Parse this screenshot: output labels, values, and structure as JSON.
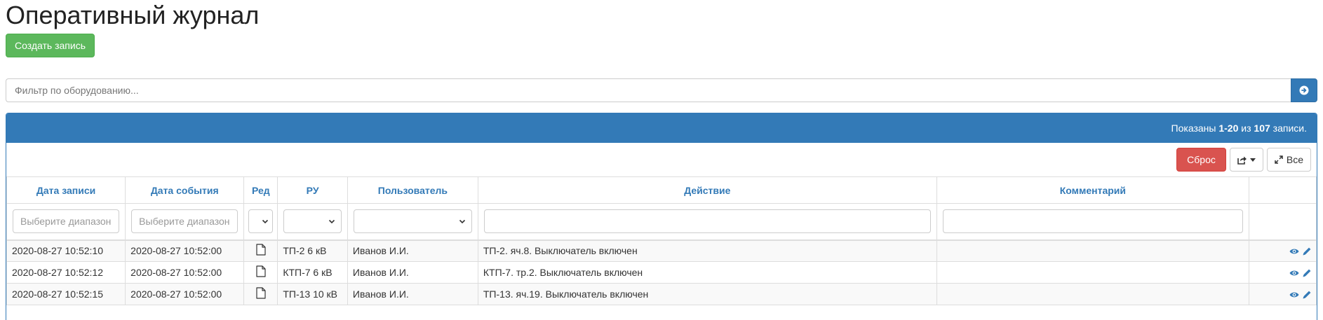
{
  "page": {
    "title": "Оперативный журнал"
  },
  "actions": {
    "create_label": "Создать запись"
  },
  "filter": {
    "placeholder": "Фильтр по оборудованию..."
  },
  "summary": {
    "prefix": "Показаны ",
    "range": "1-20",
    "middle": " из ",
    "total": "107",
    "suffix": " записи."
  },
  "toolbar": {
    "reset_label": "Сброс",
    "all_label": "Все"
  },
  "table": {
    "columns": [
      "Дата записи",
      "Дата события",
      "Ред",
      "РУ",
      "Пользователь",
      "Действие",
      "Комментарий",
      ""
    ],
    "filters": {
      "date_record_placeholder": "Выберите диапазон",
      "date_event_placeholder": "Выберите диапазон"
    },
    "rows": [
      {
        "date_record": "2020-08-27 10:52:10",
        "date_event": "2020-08-27 10:52:00",
        "ru": "ТП-2 6 кВ",
        "user": "Иванов И.И.",
        "action": "ТП-2. яч.8. Выключатель включен",
        "comment": ""
      },
      {
        "date_record": "2020-08-27 10:52:12",
        "date_event": "2020-08-27 10:52:00",
        "ru": "КТП-7 6 кВ",
        "user": "Иванов И.И.",
        "action": "КТП-7. тр.2. Выключатель включен",
        "comment": ""
      },
      {
        "date_record": "2020-08-27 10:52:15",
        "date_event": "2020-08-27 10:52:00",
        "ru": "ТП-13 10 кВ",
        "user": "Иванов И.И.",
        "action": "ТП-13. яч.19. Выключатель включен",
        "comment": ""
      }
    ]
  },
  "icons": {
    "doc": "file-icon",
    "view": "eye-icon",
    "edit": "pencil-icon",
    "go": "arrow-circle-right-icon",
    "export": "share-icon",
    "expand": "expand-icon"
  },
  "colors": {
    "primary": "#337ab7",
    "success": "#5cb85c",
    "danger": "#d9534f"
  }
}
